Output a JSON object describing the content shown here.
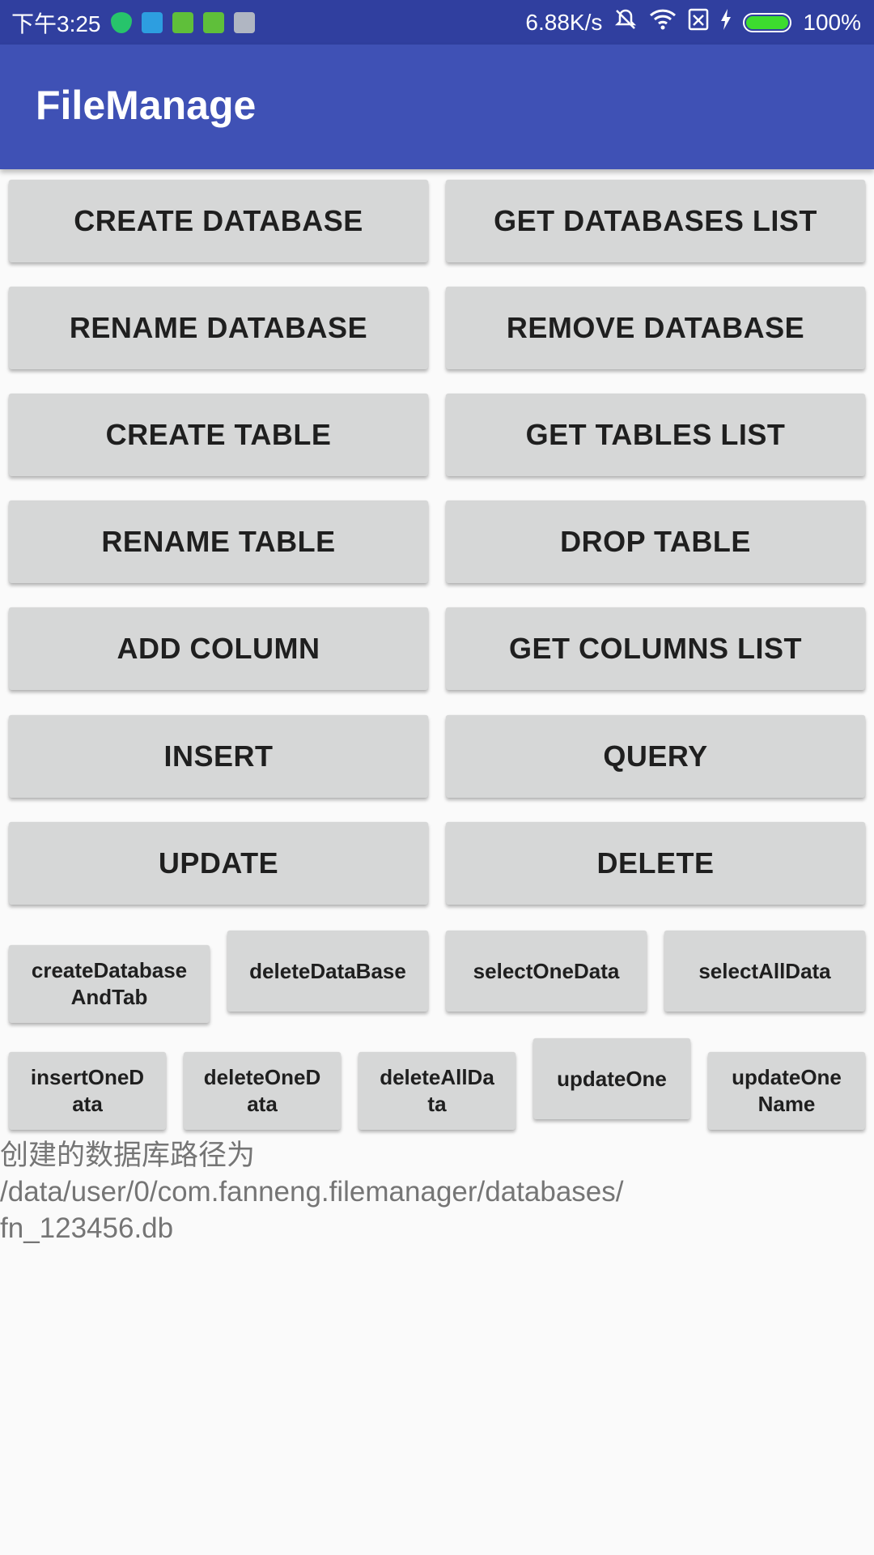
{
  "status_bar": {
    "time": "下午3:25",
    "net_speed": "6.88K/s",
    "battery": "100%"
  },
  "app_bar": {
    "title": "FileManage"
  },
  "buttons": {
    "create_database": "CREATE DATABASE",
    "get_databases_list": "GET DATABASES LIST",
    "rename_database": "RENAME DATABASE",
    "remove_database": "REMOVE DATABASE",
    "create_table": "CREATE TABLE",
    "get_tables_list": "GET TABLES LIST",
    "rename_table": "RENAME TABLE",
    "drop_table": "DROP TABLE",
    "add_column": "ADD COLUMN",
    "get_columns_list": "GET COLUMNS LIST",
    "insert": "INSERT",
    "query": "QUERY",
    "update": "UPDATE",
    "delete": "DELETE",
    "create_database_and_tab": "createDatabase\nAndTab",
    "delete_database_small": "deleteDataBase",
    "select_one_data": "selectOneData",
    "select_all_data": "selectAllData",
    "insert_one_data": "insertOneD\nata",
    "delete_one_data": "deleteOneD\nata",
    "delete_all_data": "deleteAllDa\nta",
    "update_one": "updateOne",
    "update_one_name": "updateOne\nName"
  },
  "output": {
    "text": "创建的数据库路径为\n/data/user/0/com.fanneng.filemanager/databases/\nfn_123456.db"
  }
}
